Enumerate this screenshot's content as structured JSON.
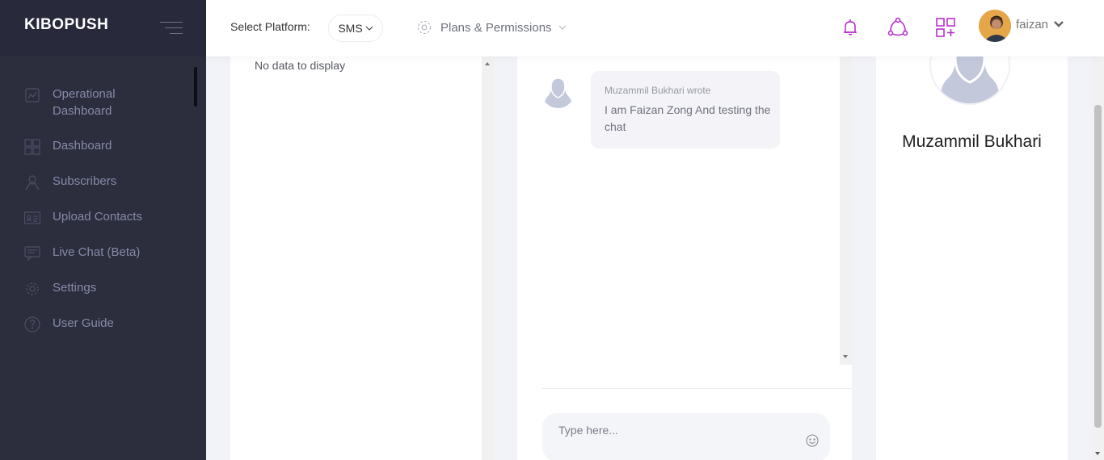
{
  "brand": "KIBOPUSH",
  "sidebar": {
    "items": [
      {
        "label": "Operational Dashboard",
        "icon": "chart-icon"
      },
      {
        "label": "Dashboard",
        "icon": "dashboard-grid-icon"
      },
      {
        "label": "Subscribers",
        "icon": "user-icon"
      },
      {
        "label": "Upload Contacts",
        "icon": "contact-card-icon"
      },
      {
        "label": "Live Chat (Beta)",
        "icon": "chat-icon"
      },
      {
        "label": "Settings",
        "icon": "gear-icon"
      },
      {
        "label": "User Guide",
        "icon": "help-icon"
      }
    ]
  },
  "header": {
    "platform_label": "Select Platform:",
    "platform_value": "SMS",
    "plans_label": "Plans & Permissions",
    "user_name": "faizan",
    "accent": "#b624c9"
  },
  "left_panel": {
    "empty_text": "No data to display"
  },
  "chat": {
    "message_author": "Muzammil Bukhari wrote",
    "message_text": "I am Faizan Zong And testing the chat",
    "input_placeholder": "Type here..."
  },
  "profile": {
    "name": "Muzammil Bukhari"
  }
}
